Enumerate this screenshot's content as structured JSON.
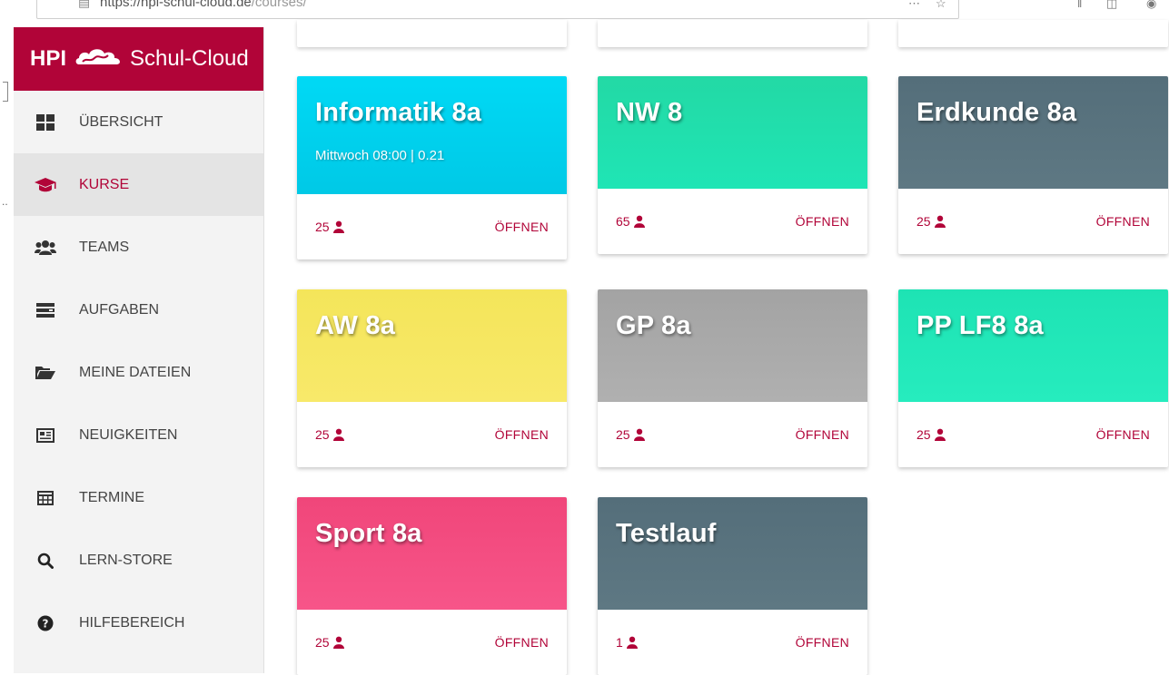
{
  "browser": {
    "url_host": "https://hpi-schul-cloud.de",
    "url_path": "/courses/"
  },
  "brand": {
    "prefix": "HPI",
    "name": "Schul-Cloud"
  },
  "sidebar": {
    "items": [
      {
        "label": "ÜBERSICHT",
        "icon": "dashboard-icon"
      },
      {
        "label": "KURSE",
        "icon": "graduation-cap-icon",
        "active": true
      },
      {
        "label": "TEAMS",
        "icon": "users-icon"
      },
      {
        "label": "AUFGABEN",
        "icon": "tasks-icon"
      },
      {
        "label": "MEINE DATEIEN",
        "icon": "folder-open-icon"
      },
      {
        "label": "NEUIGKEITEN",
        "icon": "newspaper-icon"
      },
      {
        "label": "TERMINE",
        "icon": "calendar-icon"
      },
      {
        "label": "LERN-STORE",
        "icon": "search-icon"
      },
      {
        "label": "HILFEBEREICH",
        "icon": "question-circle-icon"
      }
    ]
  },
  "courses": [
    {
      "title": "Informatik 8a",
      "subtitle": "Mittwoch 08:00 | 0.21",
      "count": "25",
      "open": "ÖFFNEN",
      "color": "#00d9f5",
      "color2": "#00c9e6"
    },
    {
      "title": "NW 8",
      "subtitle": "",
      "count": "65",
      "open": "ÖFFNEN",
      "color": "#23d9a5",
      "color2": "#1fe5b5"
    },
    {
      "title": "Erdkunde 8a",
      "subtitle": "",
      "count": "25",
      "open": "ÖFFNEN",
      "color": "#546e7a",
      "color2": "#5e7883"
    },
    {
      "title": "AW 8a",
      "subtitle": "",
      "count": "25",
      "open": "ÖFFNEN",
      "color": "#f4e55a",
      "color2": "#f8e96a"
    },
    {
      "title": "GP 8a",
      "subtitle": "",
      "count": "25",
      "open": "ÖFFNEN",
      "color": "#a3a3a3",
      "color2": "#b0b0b0"
    },
    {
      "title": "PP LF8 8a",
      "subtitle": "",
      "count": "25",
      "open": "ÖFFNEN",
      "color": "#1ee3b4",
      "color2": "#26ecbe"
    },
    {
      "title": "Sport 8a",
      "subtitle": "",
      "count": "25",
      "open": "ÖFFNEN",
      "color": "#f0467a",
      "color2": "#f75589"
    },
    {
      "title": "Testlauf",
      "subtitle": "",
      "count": "1",
      "open": "ÖFFNEN",
      "color": "#546e7a",
      "color2": "#5e7883"
    }
  ],
  "colors": {
    "brand": "#b10438",
    "sidebar_bg": "#f3f3f3",
    "active_bg": "#e4e4e4"
  }
}
